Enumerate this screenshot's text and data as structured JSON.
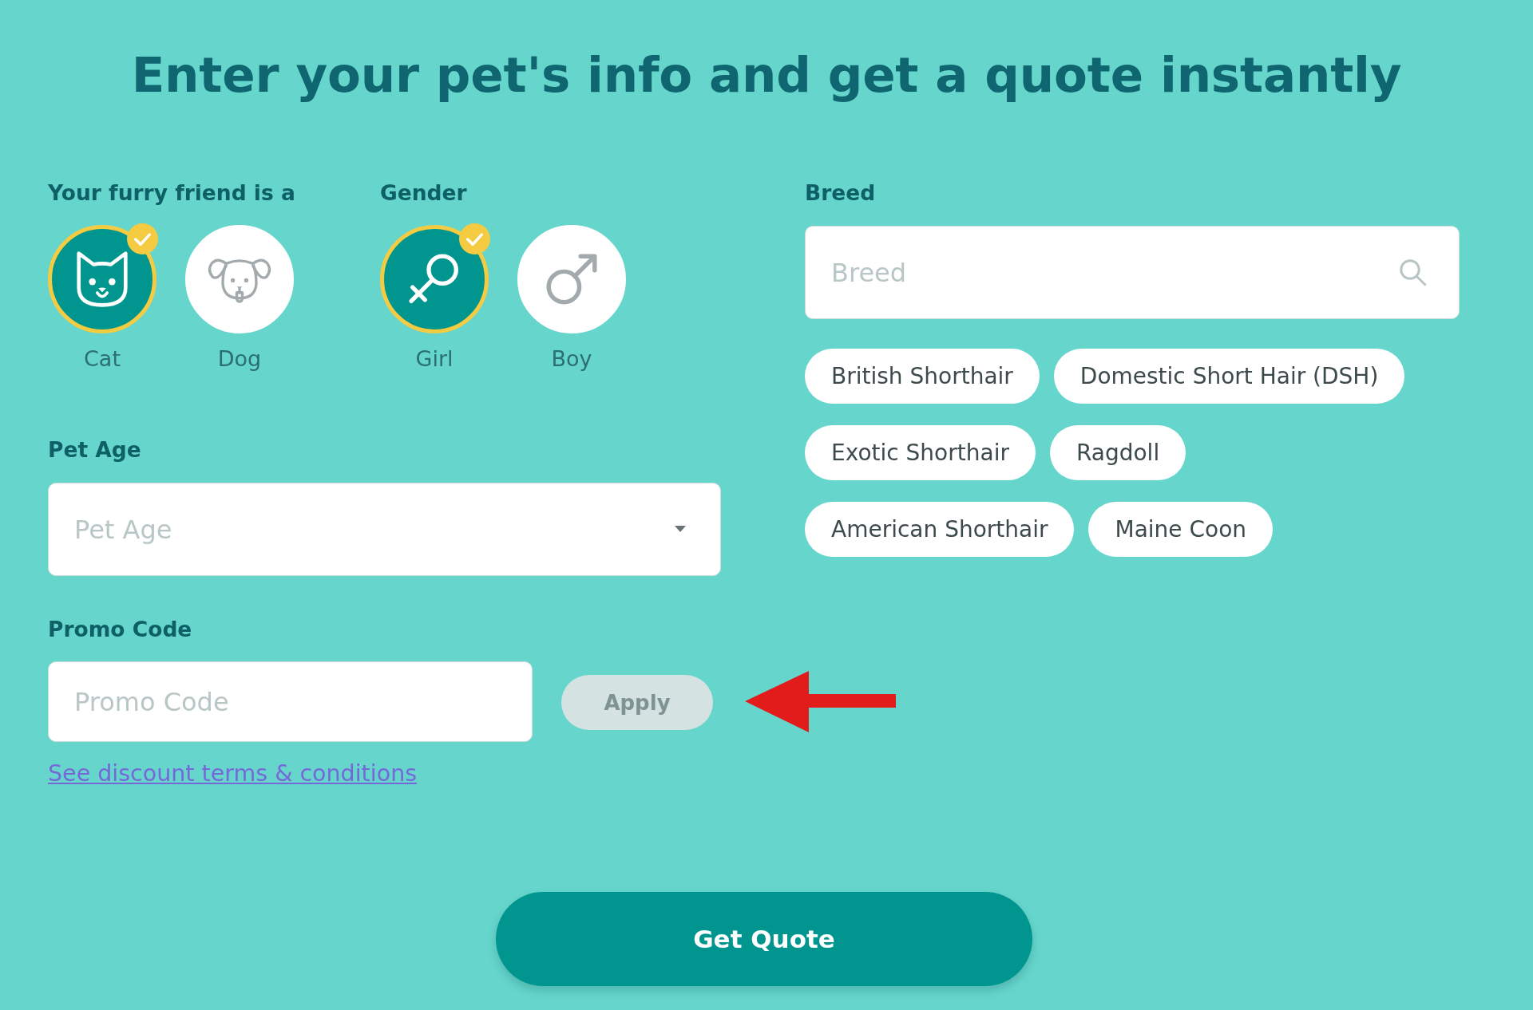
{
  "heading": "Enter your pet's info and get a quote instantly",
  "pet_type": {
    "label": "Your furry friend is a",
    "options": [
      {
        "kind": "cat",
        "label": "Cat",
        "selected": true
      },
      {
        "kind": "dog",
        "label": "Dog",
        "selected": false
      }
    ]
  },
  "gender": {
    "label": "Gender",
    "options": [
      {
        "kind": "female",
        "label": "Girl",
        "selected": true
      },
      {
        "kind": "male",
        "label": "Boy",
        "selected": false
      }
    ]
  },
  "breed": {
    "label": "Breed",
    "placeholder": "Breed",
    "suggestions": [
      "British Shorthair",
      "Domestic Short Hair (DSH)",
      "Exotic Shorthair",
      "Ragdoll",
      "American Shorthair",
      "Maine Coon"
    ]
  },
  "pet_age": {
    "label": "Pet Age",
    "placeholder": "Pet Age"
  },
  "promo_code": {
    "label": "Promo Code",
    "placeholder": "Promo Code",
    "apply_button": {
      "label": "Apply",
      "disabled": true
    },
    "terms_link": "See discount terms & conditions"
  },
  "submit_button": "Get Quote"
}
